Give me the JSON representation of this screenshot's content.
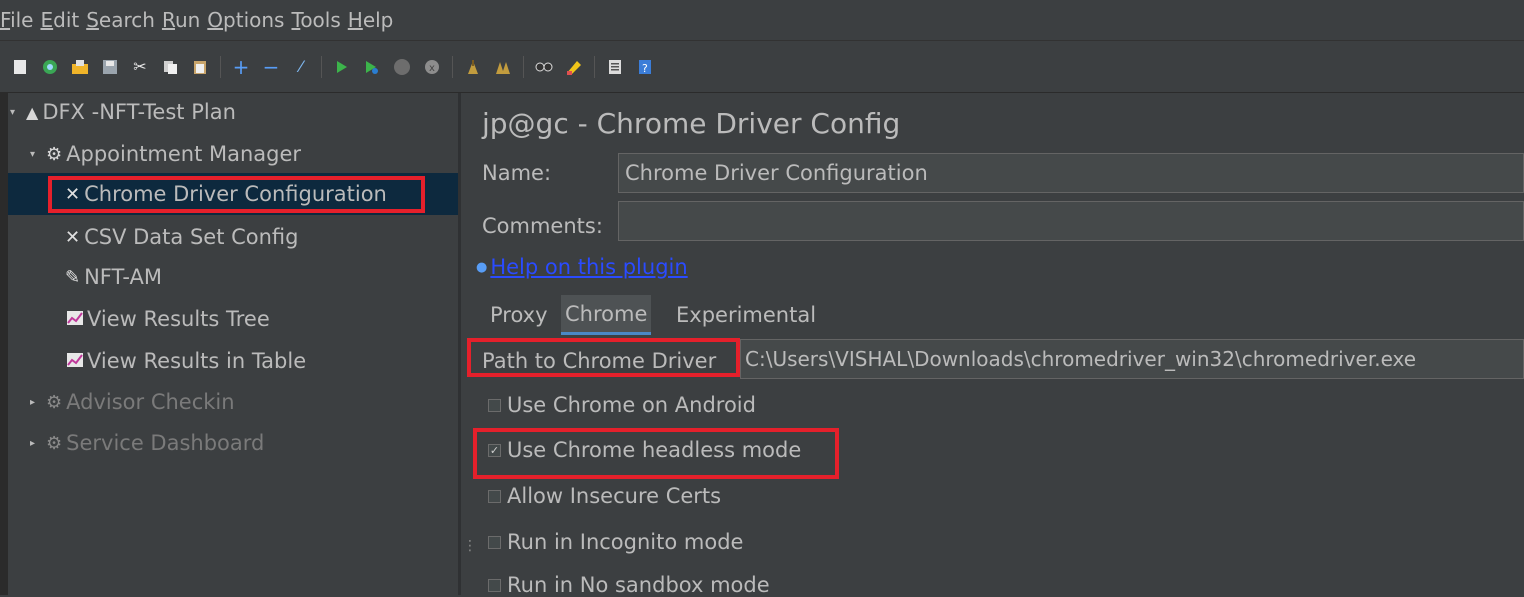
{
  "menu": [
    {
      "mnemonic": "F",
      "rest": "ile"
    },
    {
      "mnemonic": "E",
      "rest": "dit"
    },
    {
      "mnemonic": "S",
      "rest": "earch"
    },
    {
      "mnemonic": "R",
      "rest": "un"
    },
    {
      "mnemonic": "O",
      "rest": "ptions"
    },
    {
      "mnemonic": "T",
      "rest": "ools"
    },
    {
      "mnemonic": "H",
      "rest": "elp"
    }
  ],
  "toolbar": {
    "icons": [
      "new-icon",
      "templates-icon",
      "open-icon",
      "save-icon",
      "cut-icon",
      "copy-icon",
      "paste-icon",
      "expand-icon",
      "collapse-icon",
      "toggle-icon",
      "start-icon",
      "start-no-pause-icon",
      "stop-icon",
      "shutdown-icon",
      "clear-icon",
      "clear-all-icon",
      "search-icon",
      "reset-search-icon",
      "function-helper-icon",
      "help-icon"
    ]
  },
  "tree": {
    "plan": {
      "label": "DFX -NFT-Test Plan"
    },
    "group": {
      "label": "Appointment Manager"
    },
    "children": [
      {
        "label": "Chrome Driver Configuration",
        "icon": "wrench-icon"
      },
      {
        "label": "CSV Data Set Config",
        "icon": "wrench-icon"
      },
      {
        "label": "NFT-AM",
        "icon": "pencil-icon"
      },
      {
        "label": "View Results Tree",
        "icon": "graph-icon"
      },
      {
        "label": "View Results in Table",
        "icon": "graph-icon"
      }
    ],
    "disabled_groups": [
      {
        "label": "Advisor Checkin"
      },
      {
        "label": "Service Dashboard"
      }
    ]
  },
  "panel": {
    "title": "jp@gc - Chrome Driver Config",
    "name_label": "Name:",
    "name_value": "Chrome Driver Configuration",
    "comments_label": "Comments:",
    "comments_value": "",
    "help_link": "Help on this plugin",
    "tabs": [
      "Proxy",
      "Chrome",
      "Experimental"
    ],
    "active_tab": "Chrome",
    "path_label": "Path to Chrome Driver",
    "path_value": "C:\\Users\\VISHAL\\Downloads\\chromedriver_win32\\chromedriver.exe",
    "options": [
      {
        "label": "Use Chrome on Android",
        "checked": false
      },
      {
        "label": "Use Chrome headless mode",
        "checked": true
      },
      {
        "label": "Allow Insecure Certs",
        "checked": false
      },
      {
        "label": "Run in Incognito mode",
        "checked": false
      },
      {
        "label": "Run in No sandbox mode",
        "checked": false
      }
    ]
  },
  "colors": {
    "background": "#3c3f41",
    "selection": "#0d293e",
    "highlight_box": "#e5202b",
    "link": "#2a4bff"
  }
}
